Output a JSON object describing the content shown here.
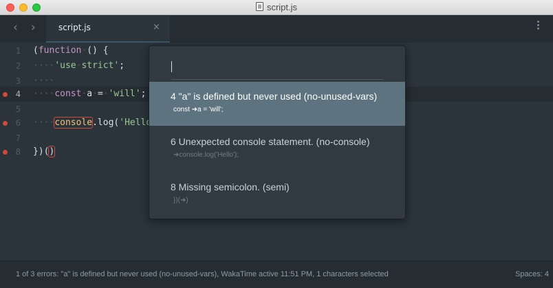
{
  "window": {
    "title": "script.js"
  },
  "tab": {
    "label": "script.js",
    "close": "×"
  },
  "nav": {
    "back": "‹",
    "forward": "›"
  },
  "editor": {
    "lines": [
      {
        "num": "1",
        "code": "(function () {"
      },
      {
        "num": "2",
        "code": "····'use strict';"
      },
      {
        "num": "3",
        "code": "····"
      },
      {
        "num": "4",
        "code": "····const a = 'will';"
      },
      {
        "num": "5",
        "code": ""
      },
      {
        "num": "6",
        "code": "····console.log('Hello')"
      },
      {
        "num": "7",
        "code": ""
      },
      {
        "num": "8",
        "code": "})()"
      }
    ],
    "errors_on_lines": [
      "4",
      "6",
      "8"
    ]
  },
  "popup": {
    "input_value": "",
    "items": [
      {
        "title": "4  \"a\" is defined but never used (no-unused-vars)",
        "sub": "const ➜a = 'will';",
        "selected": true
      },
      {
        "title": "6  Unexpected console statement. (no-console)",
        "sub": "➜console.log('Hello');",
        "selected": false
      },
      {
        "title": "8  Missing semicolon. (semi)",
        "sub": "})(➜)",
        "selected": false
      }
    ]
  },
  "status": {
    "left": "1 of 3 errors: \"a\" is defined but never used (no-unused-vars), WakaTime active 11:51 PM, 1 characters selected",
    "right": "Spaces: 4"
  },
  "colors": {
    "error": "#d04a3a",
    "selection": "#5d737f",
    "editor_bg": "#2b343b"
  }
}
